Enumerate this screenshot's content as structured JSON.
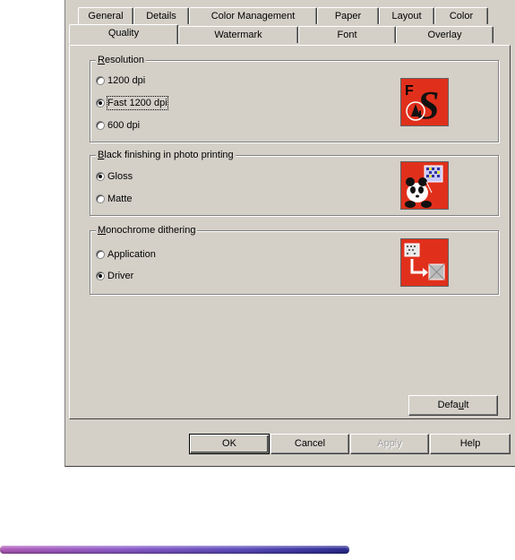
{
  "tabs_back": [
    "General",
    "Details",
    "Color Management",
    "Paper",
    "Layout",
    "Color"
  ],
  "tabs_front": [
    "Quality",
    "Watermark",
    "Font",
    "Overlay"
  ],
  "active_tab": "Quality",
  "groups": {
    "resolution": {
      "title_first": "R",
      "title_rest": "esolution",
      "options": [
        "1200 dpi",
        "Fast 1200 dpi",
        "600 dpi"
      ],
      "selected": "Fast 1200 dpi"
    },
    "black_finishing": {
      "title_first": "B",
      "title_rest": "lack finishing in photo printing",
      "options": [
        "Gloss",
        "Matte"
      ],
      "selected": "Gloss"
    },
    "dithering": {
      "title_first": "M",
      "title_rest": "onochrome dithering",
      "options": [
        "Application",
        "Driver"
      ],
      "selected": "Driver"
    }
  },
  "buttons": {
    "default_pre": "Defa",
    "default_u": "u",
    "default_post": "lt",
    "ok": "OK",
    "cancel": "Cancel",
    "apply": "Apply",
    "help": "Help"
  },
  "icon_letters": {
    "f": "F",
    "s": "S"
  },
  "colors": {
    "dialog_bg": "#d4d0c8",
    "icon_red": "#e0301c"
  }
}
